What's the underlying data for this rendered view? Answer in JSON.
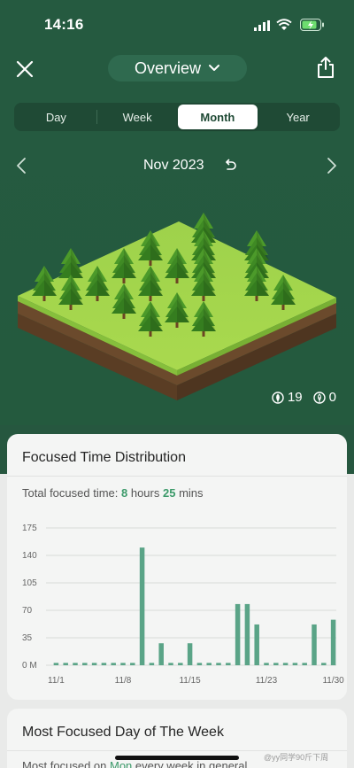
{
  "status_bar": {
    "time": "14:16"
  },
  "header": {
    "title": "Overview"
  },
  "segments": [
    {
      "label": "Day",
      "active": false
    },
    {
      "label": "Week",
      "active": false
    },
    {
      "label": "Month",
      "active": true
    },
    {
      "label": "Year",
      "active": false
    }
  ],
  "date_nav": {
    "label": "Nov 2023"
  },
  "forest": {
    "healthy_trees": "19",
    "dead_trees": "0"
  },
  "distribution_card": {
    "title": "Focused Time Distribution",
    "total_prefix": "Total focused time: ",
    "hours": "8",
    "hours_label": " hours ",
    "mins": "25",
    "mins_label": " mins"
  },
  "chart_data": {
    "type": "bar",
    "ylim": [
      0,
      175
    ],
    "yticks": [
      "175",
      "140",
      "105",
      "70",
      "35",
      "0 M"
    ],
    "ytick_values": [
      175,
      140,
      105,
      70,
      35,
      0
    ],
    "xtick_labels": [
      "11/1",
      "11/8",
      "11/15",
      "11/23",
      "11/30"
    ],
    "xtick_days": [
      1,
      8,
      15,
      23,
      30
    ],
    "color": "#5aa487",
    "categories": [
      "1",
      "2",
      "3",
      "4",
      "5",
      "6",
      "7",
      "8",
      "9",
      "10",
      "11",
      "12",
      "13",
      "14",
      "15",
      "16",
      "17",
      "18",
      "19",
      "20",
      "21",
      "22",
      "23",
      "24",
      "25",
      "26",
      "27",
      "28",
      "29",
      "30"
    ],
    "values": [
      3,
      3,
      3,
      3,
      3,
      3,
      3,
      3,
      3,
      150,
      3,
      28,
      3,
      3,
      28,
      3,
      3,
      3,
      3,
      78,
      78,
      52,
      3,
      3,
      3,
      3,
      3,
      52,
      3,
      58
    ],
    "grid": true
  },
  "week_card": {
    "title": "Most Focused Day of The Week",
    "sub_prefix": "Most focused on ",
    "day": "Mon",
    "sub_suffix": " every week in general"
  },
  "watermark": "@yy同学90斤下周"
}
